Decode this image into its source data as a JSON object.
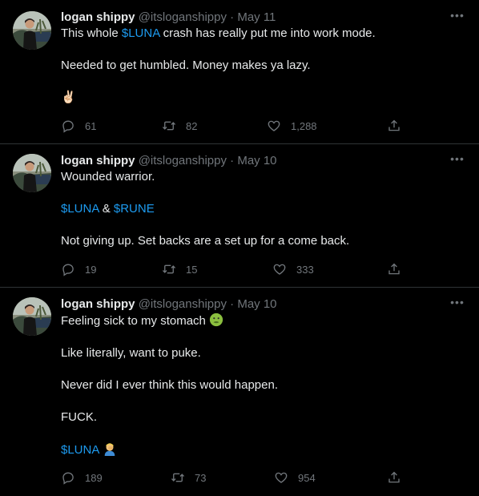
{
  "tweets": [
    {
      "name": "logan shippy",
      "handle": "@itsloganshippy",
      "sep": "·",
      "date": "May 11",
      "line1_pre": "This whole ",
      "line1_link": "$LUNA",
      "line1_post": " crash has really put me into work mode.",
      "line2": "Needed to get humbled. Money makes ya lazy.",
      "line3": "✌🏻",
      "replies": "61",
      "retweets": "82",
      "likes": "1,288"
    },
    {
      "name": "logan shippy",
      "handle": "@itsloganshippy",
      "sep": "·",
      "date": "May 10",
      "line1": "Wounded warrior.",
      "line2_link1": "$LUNA",
      "line2_mid": " & ",
      "line2_link2": "$RUNE",
      "line3": "Not giving up. Set backs are a set up for a come back.",
      "replies": "19",
      "retweets": "15",
      "likes": "333"
    },
    {
      "name": "logan shippy",
      "handle": "@itsloganshippy",
      "sep": "·",
      "date": "May 10",
      "line1": "Feeling sick to my stomach ",
      "line1_emoji": "nauseated-face-emoji",
      "line2": "Like literally, want to puke.",
      "line3": "Never did I ever think this would happen.",
      "line4": "FUCK.",
      "line5_link": "$LUNA",
      "line5_emoji": "man-facepalming-emoji",
      "replies": "189",
      "retweets": "73",
      "likes": "954"
    }
  ],
  "colors": {
    "background": "#000000",
    "text": "#e7e9ea",
    "muted": "#71767b",
    "link": "#1d9bf0",
    "divider": "#2f3336"
  },
  "icons": {
    "more": "more-icon",
    "reply": "reply-icon",
    "retweet": "retweet-icon",
    "like": "heart-icon",
    "share": "share-icon"
  }
}
